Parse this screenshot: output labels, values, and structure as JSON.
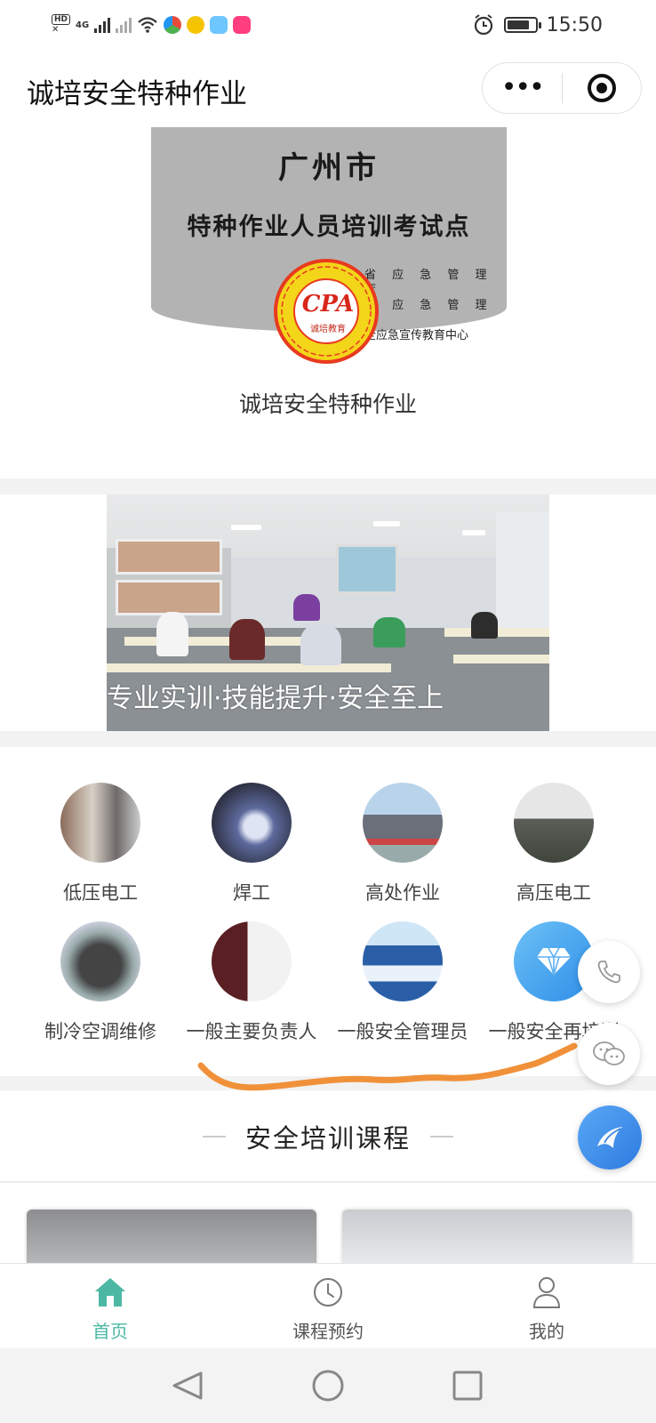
{
  "status_bar": {
    "hd_label": "HD",
    "network_label": "4G",
    "time": "15:50",
    "battery_level": 0.8
  },
  "header": {
    "title": "诚培安全特种作业",
    "more_icon": "more-dots-icon",
    "close_icon": "target-close-icon"
  },
  "logo_banner": {
    "city": "广州市",
    "subtitle": "特种作业人员培训考试点",
    "seal_text": "CPA",
    "seal_name": "诚培教育",
    "org_lines": [
      "省 应 急 管 理 厅",
      "市 应 急 管 理 局",
      "全应急宣传教育中心"
    ],
    "caption": "诚培安全特种作业"
  },
  "photo_banner": {
    "caption": "专业实训·技能提升·安全至上"
  },
  "categories": [
    {
      "label": "低压电工"
    },
    {
      "label": "焊工"
    },
    {
      "label": "高处作业"
    },
    {
      "label": "高压电工"
    },
    {
      "label": "制冷空调维修"
    },
    {
      "label": "一般主要负责人"
    },
    {
      "label": "一般安全管理员"
    },
    {
      "label": "一般安全再培训"
    }
  ],
  "section": {
    "title": "安全培训课程"
  },
  "floating": {
    "phone_icon": "phone-icon",
    "chat_icon": "chat-icon",
    "share_icon": "share-icon"
  },
  "tabbar": {
    "items": [
      {
        "label": "首页",
        "icon": "home-icon",
        "active": true
      },
      {
        "label": "课程预约",
        "icon": "clock-icon",
        "active": false
      },
      {
        "label": "我的",
        "icon": "user-icon",
        "active": false
      }
    ]
  },
  "colors": {
    "accent": "#4cb8a4",
    "scribble": "#f0913a",
    "share_fab": "#2d7be0"
  }
}
